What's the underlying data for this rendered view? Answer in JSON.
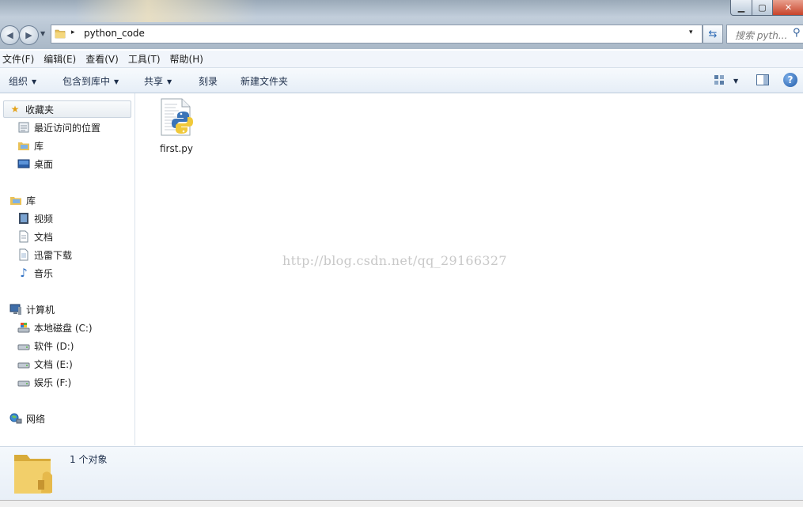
{
  "window": {
    "controls": {
      "minimize": "▁",
      "maximize": "▢",
      "close": "✕"
    }
  },
  "address_bar": {
    "crumb": "python_code",
    "separator": "▸",
    "dropdown": "▾"
  },
  "search": {
    "placeholder": "搜索 pyth..."
  },
  "menu": [
    "文件(F)",
    "编辑(E)",
    "查看(V)",
    "工具(T)",
    "帮助(H)"
  ],
  "toolbar": {
    "organize": "组织",
    "include_in_library": "包含到库中",
    "share": "共享",
    "burn": "刻录",
    "new_folder": "新建文件夹",
    "caret": "▼",
    "help": "?"
  },
  "nav": {
    "favorites": {
      "label": "收藏夹",
      "items": [
        "最近访问的位置",
        "库",
        "桌面"
      ]
    },
    "libraries": {
      "label": "库",
      "items": [
        "视频",
        "文档",
        "迅雷下载",
        "音乐"
      ]
    },
    "computer": {
      "label": "计算机",
      "items": [
        "本地磁盘 (C:)",
        "软件 (D:)",
        "文档 (E:)",
        "娱乐 (F:)"
      ]
    },
    "network": {
      "label": "网络"
    }
  },
  "files": [
    {
      "name": "first.py",
      "icon": "python-file-icon"
    }
  ],
  "watermark": "http://blog.csdn.net/qq_29166327",
  "details": {
    "count": "1 个对象"
  },
  "colors": {
    "selection": "#e8edf2",
    "toolbar_text": "#1e2f4b",
    "python_blue": "#3a74b8",
    "python_yellow": "#f0c93a"
  }
}
